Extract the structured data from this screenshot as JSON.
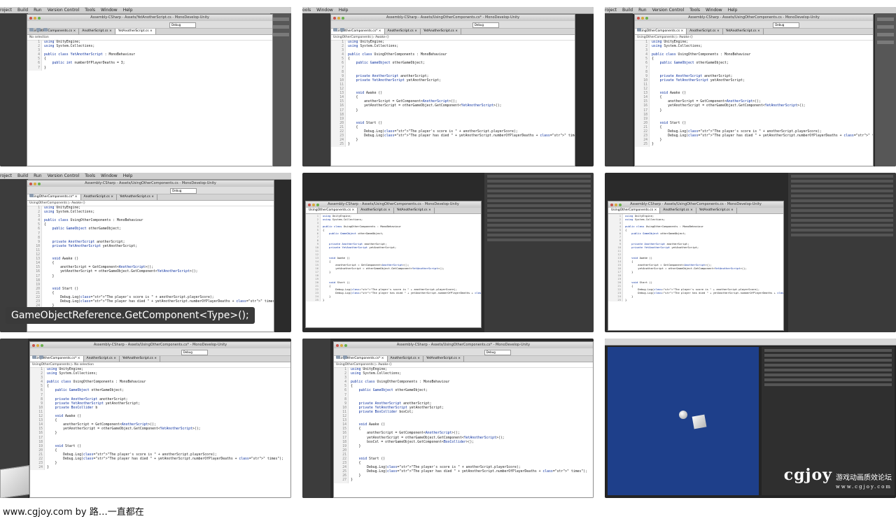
{
  "menu": {
    "t1": [
      "roject",
      "Build",
      "Run",
      "Version Control",
      "Tools",
      "Window",
      "Help"
    ],
    "t2": [
      "ools",
      "Window",
      "Help"
    ],
    "t3": [
      "roject",
      "Build",
      "Run",
      "Version Control",
      "Tools",
      "Window",
      "Help"
    ],
    "t4": [
      "roject",
      "Build",
      "Run",
      "Version Control",
      "Tools",
      "Window",
      "Help"
    ]
  },
  "titles": {
    "t1": "Assembly-CSharp - Assets/YetAnotherScript.cs - MonoDevelop-Unity",
    "t2": "Assembly-CSharp - Assets/UsingOtherComponents.cs* - MonoDevelop-Unity",
    "t3": "Assembly-CSharp - Assets/UsingOtherComponents.cs - MonoDevelop-Unity",
    "t4": "Assembly-CSharp - Assets/UsingOtherComponents.cs - MonoDevelop-Unity",
    "t7": "Assembly-CSharp - Assets/UsingOtherComponents.cs* - MonoDevelop-Unity",
    "t8": "Assembly-CSharp - Assets/UsingOtherComponents.cs* - MonoDevelop-Unity"
  },
  "debug_label": "Debug",
  "tabs": {
    "t1": [
      "UsingOtherComponents.cs",
      "AnotherScript.cs",
      "YetAnotherScript.cs"
    ],
    "t2": [
      "UsingOtherComponents.cs*",
      "AnotherScript.cs",
      "YetAnotherScript.cs"
    ],
    "t7": [
      "UsingOtherComponents.cs*",
      "AnotherScript.cs",
      "YetAnotherScript.cs"
    ]
  },
  "crumbs": {
    "t1": "No selection",
    "t2": "UsingOtherComponents ▷ Awake ()",
    "t4": "UsingOtherComponents ▷ Awake ()",
    "t7": "UsingOtherComponents ▷ No selection",
    "t8": "UsingOtherComponents ▷ Awake ()"
  },
  "code_yet_another": [
    "using UnityEngine;",
    "using System.Collections;",
    "",
    "public class YetAnotherScript : MonoBehaviour",
    "{",
    "    public int numberOfPlayerDeaths = 3;",
    "}"
  ],
  "code_using": [
    "using UnityEngine;",
    "using System.Collections;",
    "",
    "public class UsingOtherComponents : MonoBehaviour",
    "{",
    "    public GameObject otherGameObject;",
    "",
    "",
    "    private AnotherScript anotherScript;",
    "    private YetAnotherScript yetAnotherScript;",
    "",
    "",
    "    void Awake ()",
    "    {",
    "        anotherScript = GetComponent<AnotherScript>();",
    "        yetAnotherScript = otherGameObject.GetComponent<YetAnotherScript>();",
    "    }",
    "",
    "",
    "    void Start ()",
    "    {",
    "        Debug.Log(\"The player's score is \" + anotherScript.playerScore);",
    "        Debug.Log(\"The player has died \" + yetAnotherScript.numberOfPlayerDeaths + \" times\");",
    "    }",
    "}"
  ],
  "code_boxcol_partial": [
    "using UnityEngine;",
    "using System.Collections;",
    "",
    "public class UsingOtherComponents : MonoBehaviour",
    "{",
    "    public GameObject otherGameObject;",
    "",
    "    private AnotherScript anotherScript;",
    "    private YetAnotherScript yetAnotherScript;",
    "    private BoxCollider b",
    "",
    "    void Awake ()",
    "    {",
    "        anotherScript = GetComponent<AnotherScript>();",
    "        yetAnotherScript = otherGameObject.GetComponent<YetAnotherScript>();",
    "    }",
    "",
    "",
    "    void Start ()",
    "    {",
    "        Debug.Log(\"The player's score is \" + anotherScript.playerScore);",
    "        Debug.Log(\"The player has died \" + yetAnotherScript.numberOfPlayerDeaths + \" times\");",
    "    }",
    "}"
  ],
  "code_boxcol_full": [
    "using UnityEngine;",
    "using System.Collections;",
    "",
    "public class UsingOtherComponents : MonoBehaviour",
    "{",
    "    public GameObject otherGameObject;",
    "",
    "",
    "    private AnotherScript anotherScript;",
    "    private YetAnotherScript yetAnotherScript;",
    "    private BoxCollider boxCol;",
    "",
    "",
    "    void Awake ()",
    "    {",
    "        anotherScript = GetComponent<AnotherScript>();",
    "        yetAnotherScript = otherGameObject.GetComponent<YetAnotherScript>();",
    "        boxCol = otherGameObject.GetComponent<BoxCollider>();",
    "    }",
    "",
    "",
    "    void Start ()",
    "    {",
    "        Debug.Log(\"The player's score is \" + anotherScript.playerScore);",
    "        Debug.Log(\"The player has died \" + yetAnotherScript.numberOfPlayerDeaths + \" times\");",
    "    }",
    "}"
  ],
  "caption": "GameObjectReference.GetComponent<Type>();",
  "watermark": {
    "logo": "cgjoy",
    "cn": "游戏动画质效论坛",
    "url": "www.cgjoy.com"
  },
  "footer": "www.cgjoy.com by 路…一直都在"
}
